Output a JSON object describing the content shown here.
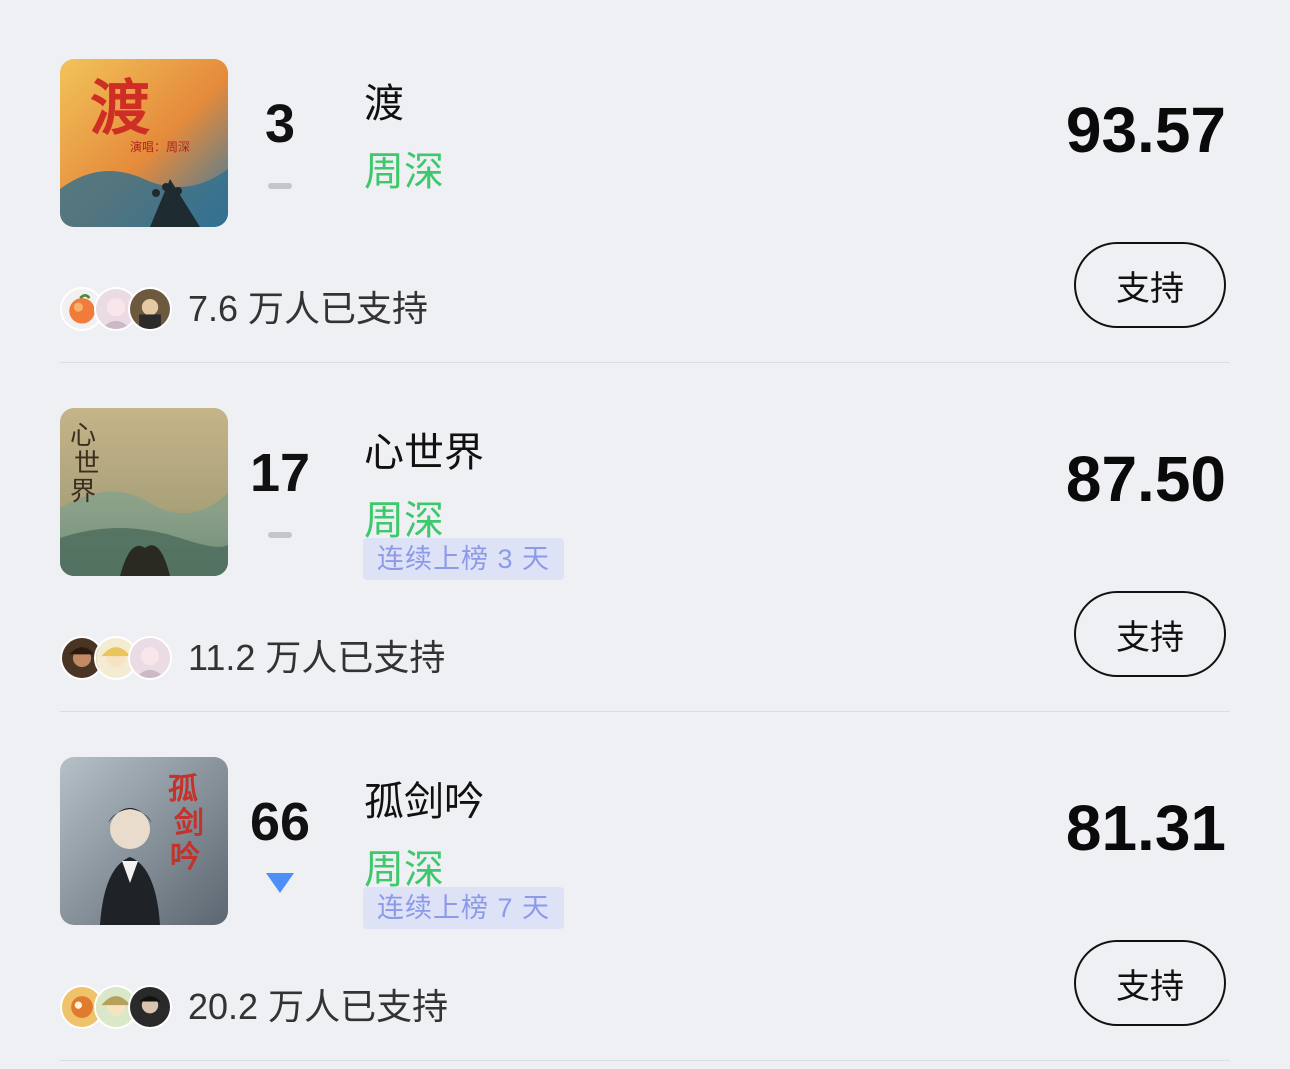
{
  "items": [
    {
      "rank": "3",
      "trend": "flat",
      "title": "渡",
      "artist": "周深",
      "streak": "",
      "score": "93.57",
      "supporters": "7.6 万人已支持",
      "button": "支持",
      "cover_colors": [
        "#e8a24a",
        "#d54b2b",
        "#3a7a9d"
      ]
    },
    {
      "rank": "17",
      "trend": "flat",
      "title": "心世界",
      "artist": "周深",
      "streak": "连续上榜 3 天",
      "score": "87.50",
      "supporters": "11.2 万人已支持",
      "button": "支持",
      "cover_colors": [
        "#b9a878",
        "#6e8c7a",
        "#3e3a2c"
      ]
    },
    {
      "rank": "66",
      "trend": "down",
      "title": "孤剑吟",
      "artist": "周深",
      "streak": "连续上榜 7 天",
      "score": "81.31",
      "supporters": "20.2 万人已支持",
      "button": "支持",
      "cover_colors": [
        "#8a98a4",
        "#2c3138",
        "#c13b33"
      ]
    }
  ],
  "colors": {
    "background": "#eef0f4",
    "artist": "#3fc86b",
    "streak_bg": "#dde2f7",
    "streak_text": "#8c9ae8",
    "trend_down": "#4e8ef7"
  }
}
